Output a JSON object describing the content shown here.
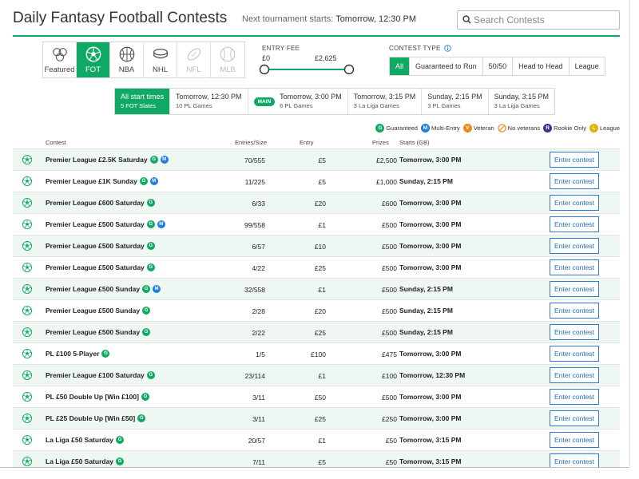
{
  "header": {
    "title": "Daily Fantasy Football Contests",
    "next_label": "Next tournament starts:",
    "next_value": "Tomorrow, 12:30 PM",
    "search_placeholder": "Search Contests"
  },
  "sports": [
    {
      "label": "Featured",
      "icon": "featured-icon",
      "state": "normal"
    },
    {
      "label": "FOT",
      "icon": "soccer-ball-icon",
      "state": "active"
    },
    {
      "label": "NBA",
      "icon": "basketball-icon",
      "state": "normal"
    },
    {
      "label": "NHL",
      "icon": "hockey-puck-icon",
      "state": "normal"
    },
    {
      "label": "NFL",
      "icon": "american-football-icon",
      "state": "disabled"
    },
    {
      "label": "MLB",
      "icon": "baseball-icon",
      "state": "disabled"
    }
  ],
  "entry_fee": {
    "label": "ENTRY FEE",
    "min": "£0",
    "max": "£2,625"
  },
  "contest_type": {
    "label": "CONTEST TYPE",
    "options": [
      "All",
      "Guaranteed to Run",
      "50/50",
      "Head to Head",
      "League"
    ],
    "selected": "All"
  },
  "start_times": [
    {
      "time": "All start times",
      "sub": "5 FOT Slates",
      "active": true,
      "main": false
    },
    {
      "time": "Tomorrow, 12:30 PM",
      "sub": "10 PL Games",
      "active": false,
      "main": false
    },
    {
      "time": "Tomorrow, 3:00 PM",
      "sub": "6 PL Games",
      "active": false,
      "main": true,
      "badge": "MAIN"
    },
    {
      "time": "Tomorrow, 3:15 PM",
      "sub": "3 La Liga Games",
      "active": false,
      "main": false
    },
    {
      "time": "Sunday, 2:15 PM",
      "sub": "3 PL Games",
      "active": false,
      "main": false
    },
    {
      "time": "Sunday, 3:15 PM",
      "sub": "3 La Liga Games",
      "active": false,
      "main": false
    }
  ],
  "legend": [
    {
      "letter": "G",
      "label": "Guaranteed",
      "color": "#10a964"
    },
    {
      "letter": "M",
      "label": "Multi-Entry",
      "color": "#1d7fe0"
    },
    {
      "letter": "V",
      "label": "Veteran",
      "color": "#e98a15"
    },
    {
      "letter": "",
      "label": "No veterans",
      "color": "#e98a15"
    },
    {
      "letter": "R",
      "label": "Rookie Only",
      "color": "#4a2b8c"
    },
    {
      "letter": "L",
      "label": "League",
      "color": "#e8b000"
    }
  ],
  "table": {
    "columns": {
      "contest": "Contest",
      "entries": "Entries/Size",
      "entry": "Entry",
      "prizes": "Prizes",
      "starts": "Starts (GB)"
    },
    "enter_label": "Enter contest",
    "rows": [
      {
        "name": "Premier League £2.5K Saturday",
        "badges": [
          "G",
          "M"
        ],
        "entries": "70/555",
        "entry": "£5",
        "prize": "£2,500",
        "start": "Tomorrow, 3:00 PM"
      },
      {
        "name": "Premier League £1K Sunday",
        "badges": [
          "G",
          "M"
        ],
        "entries": "11/225",
        "entry": "£5",
        "prize": "£1,000",
        "start": "Sunday, 2:15 PM"
      },
      {
        "name": "Premier League £600 Saturday",
        "badges": [
          "G"
        ],
        "entries": "6/33",
        "entry": "£20",
        "prize": "£600",
        "start": "Tomorrow, 3:00 PM"
      },
      {
        "name": "Premier League £500 Saturday",
        "badges": [
          "G",
          "M"
        ],
        "entries": "99/558",
        "entry": "£1",
        "prize": "£500",
        "start": "Tomorrow, 3:00 PM"
      },
      {
        "name": "Premier League £500 Saturday",
        "badges": [
          "G"
        ],
        "entries": "6/57",
        "entry": "£10",
        "prize": "£500",
        "start": "Tomorrow, 3:00 PM"
      },
      {
        "name": "Premier League £500 Saturday",
        "badges": [
          "G"
        ],
        "entries": "4/22",
        "entry": "£25",
        "prize": "£500",
        "start": "Tomorrow, 3:00 PM"
      },
      {
        "name": "Premier League £500 Sunday",
        "badges": [
          "G",
          "M"
        ],
        "entries": "32/558",
        "entry": "£1",
        "prize": "£500",
        "start": "Sunday, 2:15 PM"
      },
      {
        "name": "Premier League £500 Sunday",
        "badges": [
          "G"
        ],
        "entries": "2/28",
        "entry": "£20",
        "prize": "£500",
        "start": "Sunday, 2:15 PM"
      },
      {
        "name": "Premier League £500 Sunday",
        "badges": [
          "G"
        ],
        "entries": "2/22",
        "entry": "£25",
        "prize": "£500",
        "start": "Sunday, 2:15 PM"
      },
      {
        "name": "PL £100 5-Player",
        "badges": [
          "G"
        ],
        "entries": "1/5",
        "entry": "£100",
        "prize": "£475",
        "start": "Tomorrow, 3:00 PM"
      },
      {
        "name": "Premier League £100 Saturday",
        "badges": [
          "G"
        ],
        "entries": "23/114",
        "entry": "£1",
        "prize": "£100",
        "start": "Tomorrow, 12:30 PM"
      },
      {
        "name": "PL £50 Double Up [Win £100]",
        "badges": [
          "G"
        ],
        "entries": "3/11",
        "entry": "£50",
        "prize": "£500",
        "start": "Tomorrow, 3:00 PM"
      },
      {
        "name": "PL £25 Double Up [Win £50]",
        "badges": [
          "G"
        ],
        "entries": "3/11",
        "entry": "£25",
        "prize": "£250",
        "start": "Tomorrow, 3:00 PM"
      },
      {
        "name": "La Liga £50 Saturday",
        "badges": [
          "G"
        ],
        "entries": "20/57",
        "entry": "£1",
        "prize": "£50",
        "start": "Tomorrow, 3:15 PM"
      },
      {
        "name": "La Liga £50 Saturday",
        "badges": [
          "G"
        ],
        "entries": "7/11",
        "entry": "£5",
        "prize": "£50",
        "start": "Tomorrow, 3:15 PM"
      }
    ]
  },
  "colors": {
    "accent": "#10a964",
    "link": "#1f6fc7",
    "row_alt": "#eef7f2"
  }
}
